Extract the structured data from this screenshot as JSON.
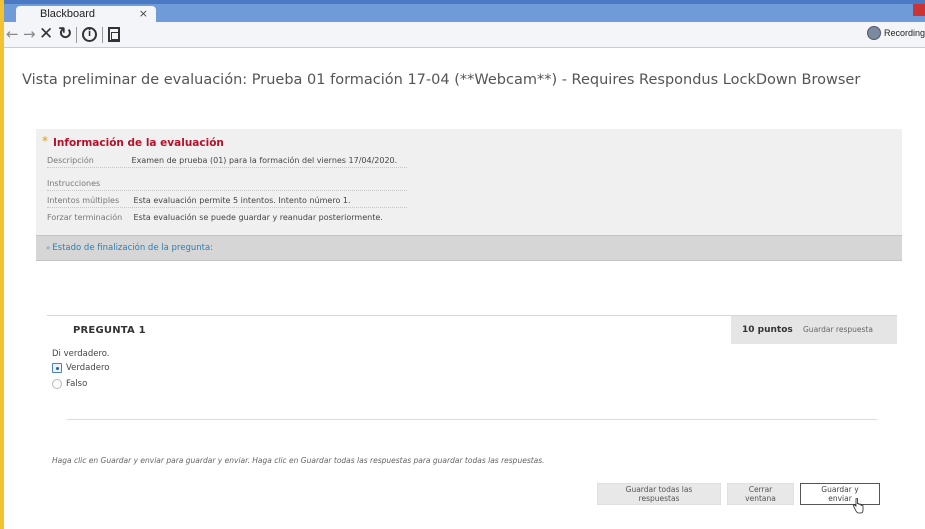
{
  "browser": {
    "tab_title": "Blackboard",
    "tab_close": "×",
    "recording_label": "Recording"
  },
  "page": {
    "title": "Vista preliminar de evaluación: Prueba 01 formación 17-04 (**Webcam**) - Requires Respondus LockDown Browser"
  },
  "info": {
    "heading": "Información de la evaluación",
    "rows": [
      {
        "label": "Descripción",
        "value": "Examen de prueba (01) para la formación del viernes 17/04/2020."
      },
      {
        "label": "Instrucciones",
        "value": ""
      },
      {
        "label": "Intentos múltiples",
        "value": "Esta evaluación permite 5 intentos. Intento número 1."
      },
      {
        "label": "Forzar terminación",
        "value": "Esta evaluación se puede guardar y reanudar posteriormente."
      }
    ]
  },
  "status": {
    "link_label": "Estado de finalización de la pregunta:"
  },
  "question": {
    "title": "PREGUNTA 1",
    "points": "10 puntos",
    "save_answer_label": "Guardar respuesta",
    "text": "Di verdadero.",
    "options": [
      {
        "label": "Verdadero",
        "selected": true
      },
      {
        "label": "Falso",
        "selected": false
      }
    ]
  },
  "footer": {
    "instructions": "Haga clic en Guardar y enviar para guardar y enviar. Haga clic en Guardar todas las respuestas para guardar todas las respuestas.",
    "save_all_label": "Guardar todas las respuestas",
    "close_window_label": "Cerrar ventana",
    "save_submit_label": "Guardar y enviar"
  },
  "colors": {
    "heading_red": "#b4102b",
    "link_blue": "#2b7fb6",
    "tabbar_blue": "#6f9bd8",
    "frame_yellow": "#f2c230"
  },
  "icons": {
    "back": "arrow-left-icon",
    "forward": "arrow-right-icon",
    "stop": "close-icon",
    "reload": "reload-icon",
    "info": "info-icon",
    "reader": "reader-icon",
    "recording": "recording-icon",
    "required": "asterisk-icon",
    "status": "chevron-down-icon"
  }
}
